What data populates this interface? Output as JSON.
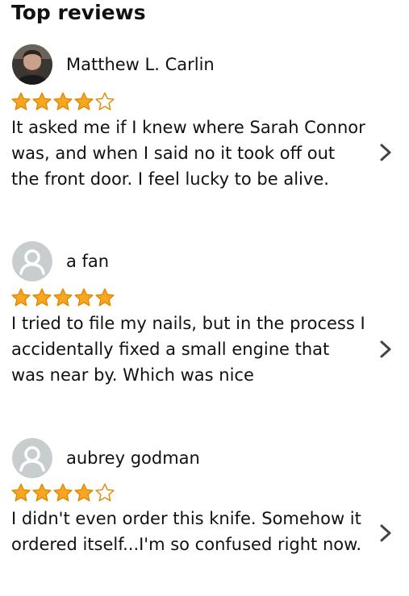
{
  "section": {
    "title": "Top reviews"
  },
  "colors": {
    "star_fill": "#f5a623",
    "star_outline": "#e08a00",
    "chevron": "#444444",
    "avatar_placeholder_bg": "#c8cdd0"
  },
  "reviews": [
    {
      "reviewer": "Matthew L. Carlin",
      "avatar": "profile-photo",
      "rating": 4,
      "max_rating": 5,
      "text": "It asked me if I knew where Sarah Connor was, and when I said no it took off out the front door. I feel lucky to be alive."
    },
    {
      "reviewer": "a fan",
      "avatar": "default-person-icon",
      "rating": 5,
      "max_rating": 5,
      "text": "I tried to file my nails, but in the process I accidentally fixed a small engine that was near by. Which was nice"
    },
    {
      "reviewer": "aubrey godman",
      "avatar": "default-person-icon",
      "rating": 4,
      "max_rating": 5,
      "text": "I didn't even order this knife. Somehow it ordered itself...I'm so confused right now."
    }
  ]
}
